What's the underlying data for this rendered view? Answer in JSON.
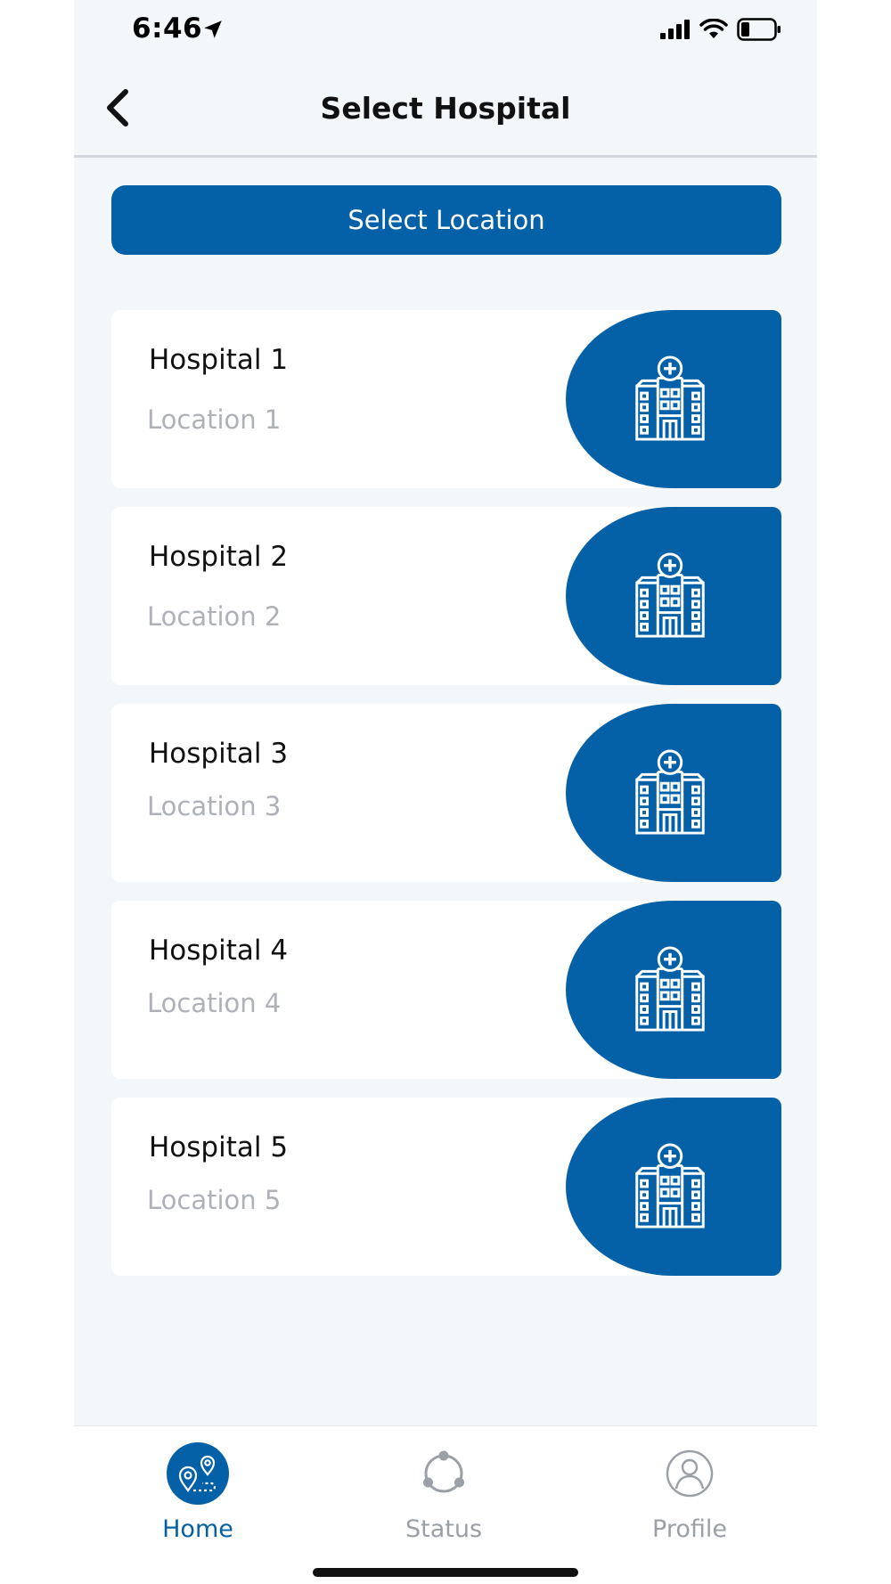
{
  "status_bar": {
    "time": "6:46"
  },
  "header": {
    "title": "Select Hospital"
  },
  "select_location": {
    "label": "Select Location"
  },
  "hospitals": [
    {
      "name": "Hospital 1",
      "location": "Location 1"
    },
    {
      "name": "Hospital 2",
      "location": "Location 2"
    },
    {
      "name": "Hospital 3",
      "location": "Location 3"
    },
    {
      "name": "Hospital 4",
      "location": "Location 4"
    },
    {
      "name": "Hospital 5",
      "location": "Location 5"
    }
  ],
  "tab_bar": {
    "items": [
      {
        "label": "Home",
        "icon": "map-route-icon",
        "active": true
      },
      {
        "label": "Status",
        "icon": "status-cycle-icon",
        "active": false
      },
      {
        "label": "Profile",
        "icon": "user-circle-icon",
        "active": false
      }
    ]
  },
  "colors": {
    "accent": "#0561a7",
    "background": "#f3f7fa",
    "inactive": "#9aa0a6",
    "secondary_text": "#aeb2b8"
  }
}
